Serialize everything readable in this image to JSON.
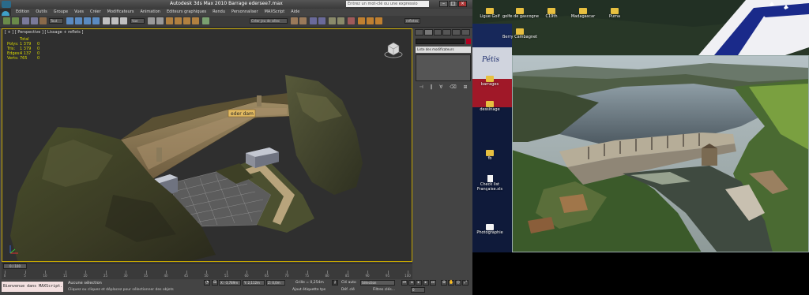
{
  "max": {
    "title": "Autodesk 3ds Max  2010     Barrage edersee7.max",
    "search_placeholder": "Entrez un mot-clé ou une expressio",
    "menu": [
      "Edition",
      "Outils",
      "Groupe",
      "Vues",
      "Créer",
      "Modificateurs",
      "Animation",
      "Editeurs graphiques",
      "Rendu",
      "Personnaliser",
      "MAXScript",
      "Aide"
    ],
    "toolbar": {
      "filter_value": "Tout",
      "view_value": "Vue",
      "selection_set_placeholder": "Créer jeu de sélec",
      "viewport_drop": "refletes"
    },
    "viewport": {
      "label": "[ + ] [ Perspective ] [ Lissage + reflets ]",
      "stats_header": "Total",
      "stats": [
        {
          "k": "Polys:",
          "v1": "1 379",
          "v2": "0"
        },
        {
          "k": "Tris:",
          "v1": "1 379",
          "v2": "0"
        },
        {
          "k": "Edges:",
          "v1": "4 137",
          "v2": "0"
        },
        {
          "k": "Verts:",
          "v1": "765",
          "v2": "0"
        }
      ],
      "object_label": "eder dam"
    },
    "command_panel": {
      "modifier_list": "Liste des modificateurs",
      "stack_buttons": [
        "⊣",
        "‖",
        "∀",
        "⌫",
        "⊞"
      ]
    },
    "timeslider": {
      "position": "0 / 100",
      "ticks": [
        "0",
        "5",
        "10",
        "15",
        "20",
        "25",
        "30",
        "35",
        "40",
        "45",
        "50",
        "55",
        "60",
        "65",
        "70",
        "75",
        "80",
        "85",
        "90",
        "95",
        "100"
      ]
    },
    "status": {
      "maxscript": "Bienvenue dans MAXScript.",
      "selection_info": "Aucune sélection",
      "prompt": "Cliquez ou cliquez et déplacez pour sélectionner des objets",
      "x": "X: -3,789m",
      "y": "Y: 2,112m",
      "z": "Z: 0,0m",
      "grid": "Grille = 0,254m",
      "autokey_label": "Clé auto",
      "autokey_value": "Sélection",
      "setkey_label": "Déf. clé",
      "filters": "Filtres clés...",
      "add_time_tag": "Ajout étiquette tps",
      "frame": "0"
    }
  },
  "desktop": {
    "icons": [
      {
        "label": "Ligue Golf"
      },
      {
        "label": "golfe de gascogne"
      },
      {
        "label": "C19th"
      },
      {
        "label": "Madagascar"
      },
      {
        "label": "Puma"
      },
      {
        "label": "Berry Cambagnet"
      },
      {
        "label": "barrages"
      },
      {
        "label": "dessinage"
      },
      {
        "label": "fb"
      },
      {
        "label": "Check list Française.xls"
      },
      {
        "label": "Photographie"
      }
    ]
  },
  "colors": {
    "viewport_border": "#c6a700",
    "stats_text": "#d8d800",
    "max_bg": "#444444",
    "maxscript_bg": "#f3e0e0"
  }
}
